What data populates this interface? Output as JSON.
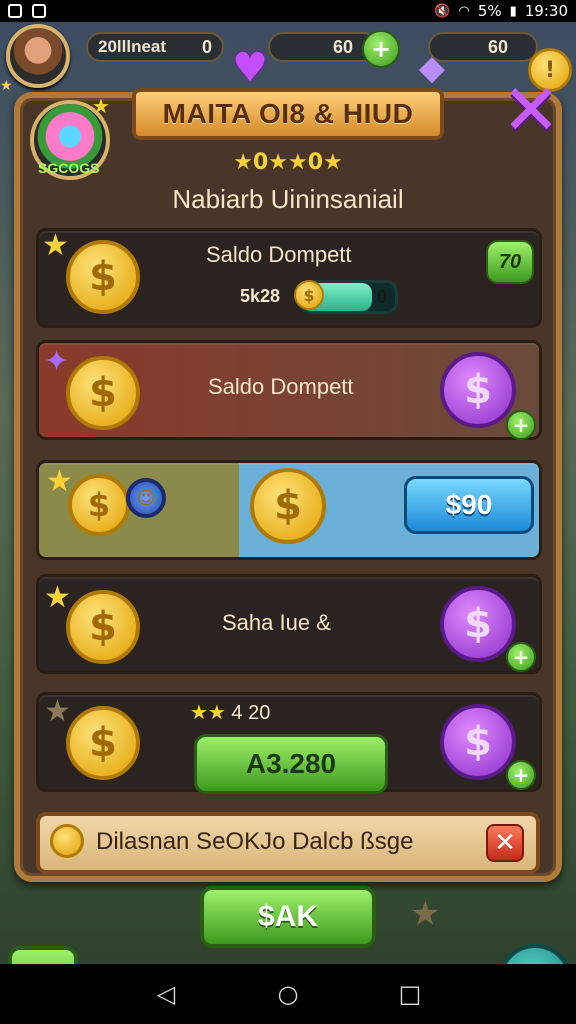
{
  "status_bar": {
    "time": "19:30",
    "battery": "5%"
  },
  "top_bar": {
    "resource1_label": "20lllneat",
    "resource1_value": "0",
    "resource2_value": "60",
    "resource3_value": "60"
  },
  "panel": {
    "title": "MAITA OI8 & HIUD",
    "badge_label": "SGCOGS",
    "stars_text": "★0★★0★",
    "subtitle": "Nabiarb Uininsaniail"
  },
  "rows": [
    {
      "title": "Saldo Dompett",
      "progress_prefix": "5k28",
      "progress_value": "0",
      "badge": "70",
      "progress_fraction": 0.75
    },
    {
      "title": "Saldo Dompett"
    },
    {
      "price": "$90"
    },
    {
      "title": "Saha Iue &"
    },
    {
      "stars_text": "4 20",
      "button": "A3.280"
    }
  ],
  "footer": {
    "message": "Dilasnan SeOKJo Dalcb ßsge",
    "close": "✕"
  },
  "ok_button": "$AK",
  "colors": {
    "panel_bg": "#4a3628",
    "panel_border": "#b07a3a",
    "accent_green": "#3d9a1e",
    "accent_purple": "#8a2fc8",
    "gold": "#e0a000"
  }
}
